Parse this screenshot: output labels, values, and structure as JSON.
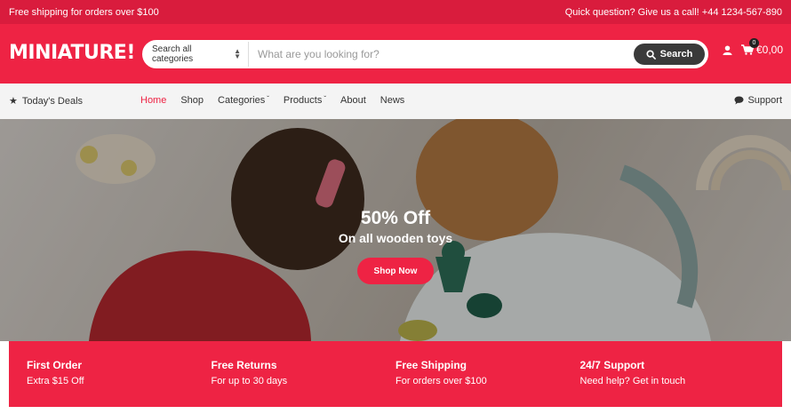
{
  "topbar": {
    "promo": "Free shipping for orders over $100",
    "contact": "Quick question? Give us a call! +44 1234-567-890"
  },
  "header": {
    "logo": "MINIATURE!",
    "category_select": "Search all categories",
    "search_placeholder": "What are you looking for?",
    "search_button": "Search",
    "cart_count": "0",
    "cart_total": "€0,00"
  },
  "nav": {
    "deals": "Today's Deals",
    "items": [
      {
        "label": "Home",
        "active": true
      },
      {
        "label": "Shop"
      },
      {
        "label": "Categories",
        "dropdown": true
      },
      {
        "label": "Products",
        "dropdown": true
      },
      {
        "label": "About"
      },
      {
        "label": "News"
      }
    ],
    "support": "Support"
  },
  "hero": {
    "title": "50% Off",
    "subtitle": "On all wooden toys",
    "button": "Shop Now"
  },
  "features": [
    {
      "title": "First Order",
      "text": "Extra $15 Off"
    },
    {
      "title": "Free Returns",
      "text": "For up to 30 days"
    },
    {
      "title": "Free Shipping",
      "text": "For orders over $100"
    },
    {
      "title": "24/7 Support",
      "text": "Need help? Get in touch"
    }
  ],
  "colors": {
    "brand": "#ee2344",
    "topbar": "#d91c3d",
    "search_button": "#3a3a3a"
  },
  "icons": [
    "search-icon",
    "user-icon",
    "cart-icon",
    "star-icon",
    "chat-icon",
    "chevron-down-icon"
  ]
}
